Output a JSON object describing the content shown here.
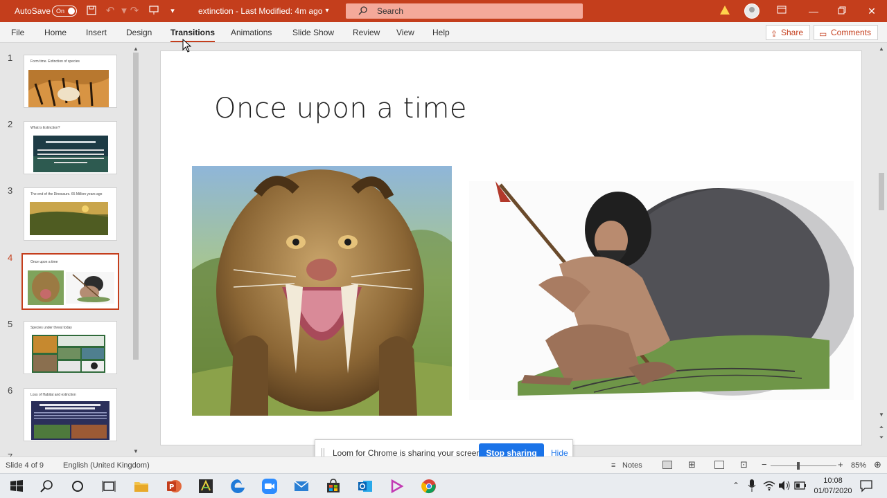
{
  "titlebar": {
    "autosave_label": "AutoSave",
    "autosave_state": "On",
    "doc_name": "extinction  -  Last Modified: 4m ago",
    "search_placeholder": "Search",
    "accent_color": "#c43e1c"
  },
  "ribbon": {
    "tabs": [
      "File",
      "Home",
      "Insert",
      "Design",
      "Transitions",
      "Animations",
      "Slide Show",
      "Review",
      "View",
      "Help"
    ],
    "active_tab": "Transitions",
    "share_label": "Share",
    "comments_label": "Comments"
  },
  "thumbnails": [
    {
      "number": "1",
      "title": "Form time.  Extinction of species"
    },
    {
      "number": "2",
      "title": "What is Extinction?"
    },
    {
      "number": "3",
      "title": "The end of the Dinosaurs. 65 Million years ago"
    },
    {
      "number": "4",
      "title": "Once upon a time"
    },
    {
      "number": "5",
      "title": "Species under threat today"
    },
    {
      "number": "6",
      "title": "Loss of Habitat and extinction"
    }
  ],
  "slide": {
    "title": "Once upon a time"
  },
  "loom": {
    "message": "Loom for Chrome is sharing your screen.",
    "stop_label": "Stop sharing",
    "hide_label": "Hide"
  },
  "statusbar": {
    "slide_counter": "Slide 4 of 9",
    "language": "English (United Kingdom)",
    "notes_label": "Notes",
    "zoom_percent": "85%"
  },
  "taskbar": {
    "time": "10:08",
    "date": "01/07/2020"
  }
}
